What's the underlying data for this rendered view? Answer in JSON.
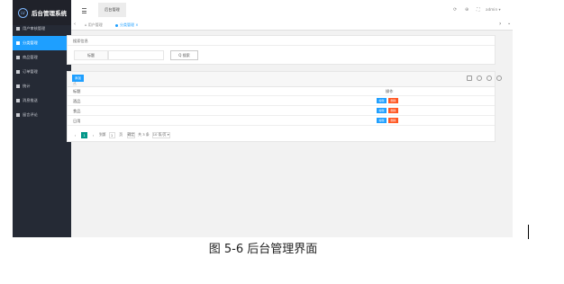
{
  "app": {
    "title": "后台管理系统",
    "logo_mark": "LV"
  },
  "sidebar": {
    "items": [
      {
        "label": "用户审核管理",
        "active": false
      },
      {
        "label": "分类管理",
        "active": true
      },
      {
        "label": "商品管理",
        "active": false
      },
      {
        "label": "订单管理",
        "active": false
      },
      {
        "label": "统计",
        "active": false
      },
      {
        "label": "消息推送",
        "active": false
      },
      {
        "label": "留言评论",
        "active": false
      }
    ]
  },
  "header": {
    "top_tab": "后台管理",
    "admin": "admin ▾",
    "icons": [
      "⟳",
      "⊕",
      "⛶"
    ]
  },
  "tabbar": {
    "left_arrow": "‹",
    "tabs": [
      "⌂ 用户管理",
      "分类管理 ×"
    ],
    "right_arrow": "›",
    "dropdown": "⌄"
  },
  "search": {
    "title": "搜索信息",
    "field_label": "标题",
    "field_value": "",
    "button": "Q 搜索"
  },
  "table": {
    "add_button": "添加",
    "columns": [
      "标题",
      "操作"
    ],
    "rows": [
      {
        "title": "酒品"
      },
      {
        "title": "食品"
      },
      {
        "title": "日用"
      }
    ],
    "edit_label": "编辑",
    "delete_label": "删除"
  },
  "pager": {
    "prev": "‹",
    "current": "1",
    "next": "›",
    "goto_label": "到第",
    "page_value": "1",
    "page_unit": "页",
    "confirm": "确定",
    "total": "共 3 条",
    "page_size": "10 条/页 ▾"
  },
  "caption": "图 5-6 后台管理界面",
  "colors": {
    "sidebar": "#252a35",
    "accent": "#1e9fff",
    "danger": "#ff5722",
    "pager_current": "#009688"
  }
}
